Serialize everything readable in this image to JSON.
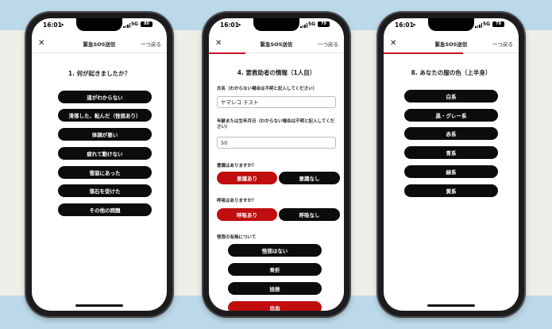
{
  "colors": {
    "accent": "#c00d0d",
    "pill_dark": "#0c0c0c",
    "band": "#bcd9ea",
    "background": "#eeeee8"
  },
  "status": {
    "time": "16:01",
    "network": "5G",
    "battery_left": "80",
    "battery_mid": "79",
    "battery_right": "79"
  },
  "header": {
    "title": "緊急SOS送信",
    "back": "一つ戻る",
    "close_icon": "close-icon"
  },
  "left": {
    "question": "1. 何が起きましたか？",
    "options": [
      "道がわからない",
      "滑落した、転んだ（怪我あり）",
      "体調が悪い",
      "疲れて動けない",
      "雪崩にあった",
      "落石を受けた",
      "その他の問題"
    ]
  },
  "middle": {
    "question": "4. 要救助者の情報（1人目）",
    "name_label": "氏名（わからない場合は不明と記入してください）",
    "name_value": "ヤマレコ テスト",
    "age_label": "年齢または生年月日（わからない場合は不明と記入してください）",
    "age_value": "50",
    "conscious_label": "意識はありますか？",
    "conscious_yes": "意識あり",
    "conscious_no": "意識なし",
    "breath_label": "呼吸はありますか？",
    "breath_yes": "呼吸あり",
    "breath_no": "呼吸なし",
    "injury_label": "怪我の有無について",
    "injury_options": [
      "怪我はない",
      "骨折",
      "捻挫",
      "出血"
    ]
  },
  "right": {
    "question": "8. あなたの服の色（上半身）",
    "options": [
      "白系",
      "黒・グレー系",
      "赤系",
      "青系",
      "緑系",
      "黄系"
    ]
  }
}
